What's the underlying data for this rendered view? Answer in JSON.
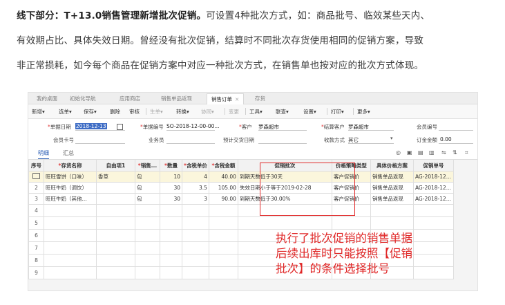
{
  "intro": {
    "bold": "线下部分：T+13.0销售管理新增批次促销。",
    "line1": "可设置4种批次方式，如：商品批号、临效某些天内、",
    "line2": "有效期占比、具体失效日期。曾经没有批次促销，结算时不同批次存货使用相同的促销方案，导致",
    "line3": "非正常损耗，如今每个商品在促销方案中对应一种批次方式，在销售单也按对应的批次方式体现。"
  },
  "tabs": [
    "我的桌面",
    "初始化导航",
    "应用商店",
    "销售单品返现",
    "销售订单",
    "存货"
  ],
  "active_tab_close": "×",
  "toolbar": {
    "items": [
      "新增",
      "选单",
      "保存",
      "删除",
      "审核",
      "生单",
      "转换",
      "协同",
      "变更",
      "工具",
      "联查",
      "设置",
      "打印",
      "更多"
    ],
    "dropdown_mark": "▾"
  },
  "form": {
    "doc_date_label": "单据日期",
    "doc_date_value": "2018-12-13",
    "doc_no_label": "单据编号",
    "doc_no_value": "SO-2018-12-00-00...",
    "customer_label": "客户",
    "customer_value": "罗森超市",
    "settle_customer_label": "结算客户",
    "settle_customer_value": "罗森超市",
    "member_no_label": "会员编号",
    "member_card_label": "会员卡号",
    "salesperson_label": "业务员",
    "delivery_date_label": "预计交货日期",
    "payment_label": "收款方式",
    "payment_value": "其它",
    "order_amount_label": "订金金额",
    "order_amount_value": "0.00"
  },
  "subtabs": [
    "明细",
    "汇总"
  ],
  "grid_icons": [
    "◎",
    "▣",
    "▤",
    "▥",
    "⇋",
    "⇅",
    "⌗"
  ],
  "grid": {
    "headers": [
      "序号",
      "存货名称",
      "自由项1",
      "销售...",
      "数量",
      "含税单价",
      "含税金额",
      "促销批次",
      "价格策略类型",
      "具体价格方案",
      "促销单号"
    ],
    "required": [
      false,
      true,
      false,
      true,
      true,
      true,
      true,
      false,
      false,
      false,
      false
    ],
    "rows": [
      [
        "1",
        "旺旺雪饼（口味）",
        "香草",
        "包",
        "10",
        "4",
        "40.00",
        "到期天数低于30天",
        "客户促销价",
        "销售单品返现",
        "AG-2018-12..."
      ],
      [
        "2",
        "旺旺牛奶（调饮）",
        "",
        "包",
        "30",
        "3.5",
        "105.00",
        "失效日期小于等于2019-02-28",
        "客户促销价",
        "销售单品返现",
        "AG-2018-12..."
      ],
      [
        "3",
        "旺旺牛奶（其他...",
        "",
        "包",
        "30",
        "3",
        "90.00",
        "到期天数低于30.00%",
        "客户促销价",
        "销售单品返现",
        "AG-2018-12..."
      ]
    ],
    "empty_rows": [
      "4",
      "5",
      "6",
      "7",
      "8",
      "9"
    ]
  },
  "annotation": {
    "line1": "执行了批次促销的销售单据",
    "line2": "后续出库时只能按照【促销",
    "line3": "批次】的条件选择批号"
  },
  "colors": {
    "accent": "#2d5fb5",
    "highlight_red": "#e02727",
    "row_highlight": "#fbf6dc"
  }
}
